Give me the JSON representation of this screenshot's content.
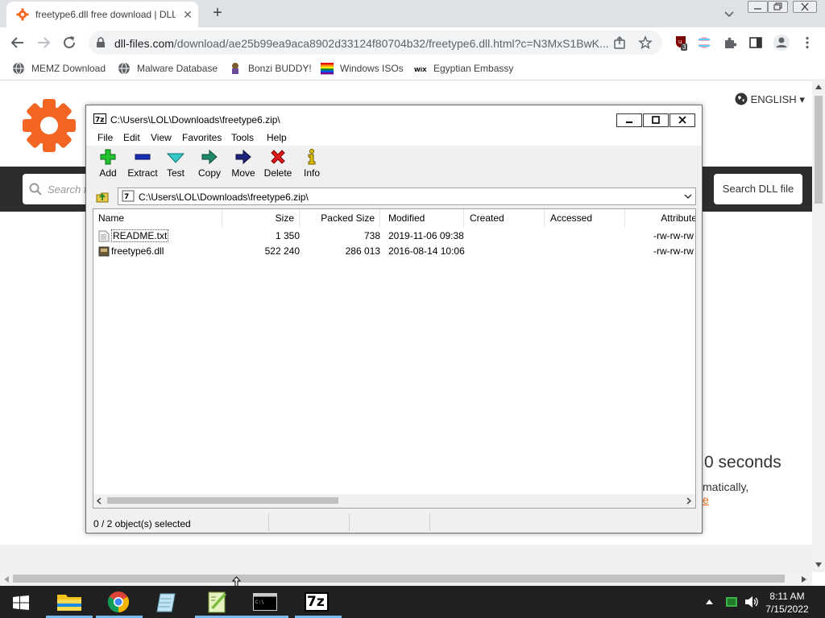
{
  "browser": {
    "tab_title": "freetype6.dll free download | DLL",
    "new_tab": "+",
    "url_domain": "dll-files.com",
    "url_path": "/download/ae25b99ea9aca8902d33124f80704b32/freetype6.dll.html?c=N3MxS1BwK...",
    "extension_badge": "3"
  },
  "bookmarks": [
    {
      "label": "MEMZ Download",
      "icon": "globe-icon"
    },
    {
      "label": "Malware Database",
      "icon": "globe-icon"
    },
    {
      "label": "Bonzi BUDDY!",
      "icon": "bonzi-icon"
    },
    {
      "label": "Windows ISOs",
      "icon": "windows-flag-icon"
    },
    {
      "label": "Egyptian Embassy",
      "icon": "wix-icon"
    }
  ],
  "site": {
    "language": "ENGLISH",
    "search_placeholder": "Search f",
    "search_button": "Search DLL file",
    "countdown_text": "0 seconds",
    "auto_text": "matically,",
    "link_text": "e",
    "accent_color": "#f26522"
  },
  "zip": {
    "title": "C:\\Users\\LOL\\Downloads\\freetype6.zip\\",
    "menu": [
      "File",
      "Edit",
      "View",
      "Favorites",
      "Tools",
      "Help"
    ],
    "tools": [
      "Add",
      "Extract",
      "Test",
      "Copy",
      "Move",
      "Delete",
      "Info"
    ],
    "address": "C:\\Users\\LOL\\Downloads\\freetype6.zip\\",
    "columns": [
      "Name",
      "Size",
      "Packed Size",
      "Modified",
      "Created",
      "Accessed",
      "Attribute"
    ],
    "files": [
      {
        "name": "README.txt",
        "size": "1 350",
        "packed": "738",
        "modified": "2019-11-06 09:38",
        "attr": "-rw-rw-rw"
      },
      {
        "name": "freetype6.dll",
        "size": "522 240",
        "packed": "286 013",
        "modified": "2016-08-14 10:06",
        "attr": "-rw-rw-rw"
      }
    ],
    "status": "0 / 2 object(s) selected"
  },
  "taskbar": {
    "time": "8:11 AM",
    "date": "7/15/2022",
    "zip_label": "7z"
  }
}
